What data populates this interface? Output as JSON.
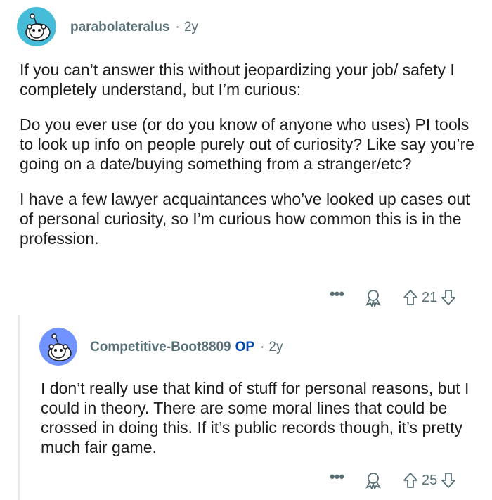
{
  "comments": [
    {
      "username": "parabolateralus",
      "is_op": false,
      "op_label": "",
      "separator": "·",
      "age": "2y",
      "paragraphs": [
        "If you can’t answer this without jeopardizing your job/ safety I completely understand, but I’m curious:",
        "Do you ever use (or do you know of anyone who uses) PI tools to look up info on people purely out of curiosity? Like say you’re going on a date/buying something from a stranger/etc?",
        "I have a few lawyer acquaintances who’ve looked up cases out of personal curiosity, so I’m curious how common this is in the profession."
      ],
      "more_label": "•••",
      "score": "21",
      "avatar_color": "#46bcd9"
    },
    {
      "username": "Competitive-Boot8809",
      "is_op": true,
      "op_label": "OP",
      "separator": "·",
      "age": "2y",
      "paragraphs": [
        "I don’t really use that kind of stuff for personal reasons, but I could in theory. There are some moral lines that could be crossed in doing this. If it’s public records though, it’s pretty much fair game."
      ],
      "more_label": "•••",
      "score": "25",
      "avatar_color": "#7193ff"
    }
  ],
  "icons": {
    "more": "more-options-icon",
    "award": "award-icon",
    "upvote": "upvote-icon",
    "downvote": "downvote-icon",
    "avatar": "snoo-avatar-icon"
  }
}
